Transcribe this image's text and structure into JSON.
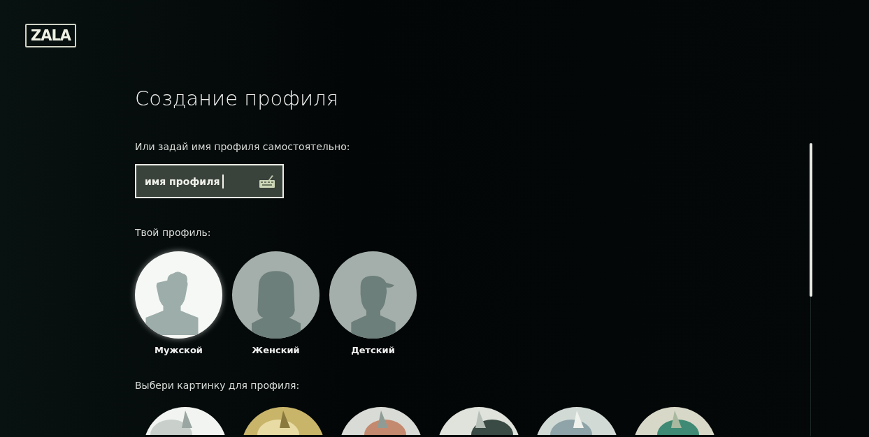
{
  "logo": "ZALA",
  "title": "Создание профиля",
  "name_prompt": "Или задай имя профиля самостоятельно:",
  "name_field": {
    "value": "имя профиля",
    "focused": true
  },
  "profile_prompt": "Твой профиль:",
  "profile_types": [
    {
      "kind": "male",
      "label": "Мужской",
      "selected": true
    },
    {
      "kind": "female",
      "label": "Женский",
      "selected": false
    },
    {
      "kind": "child",
      "label": "Детский",
      "selected": false
    }
  ],
  "picture_prompt": "Выбери картинку для профиля:"
}
